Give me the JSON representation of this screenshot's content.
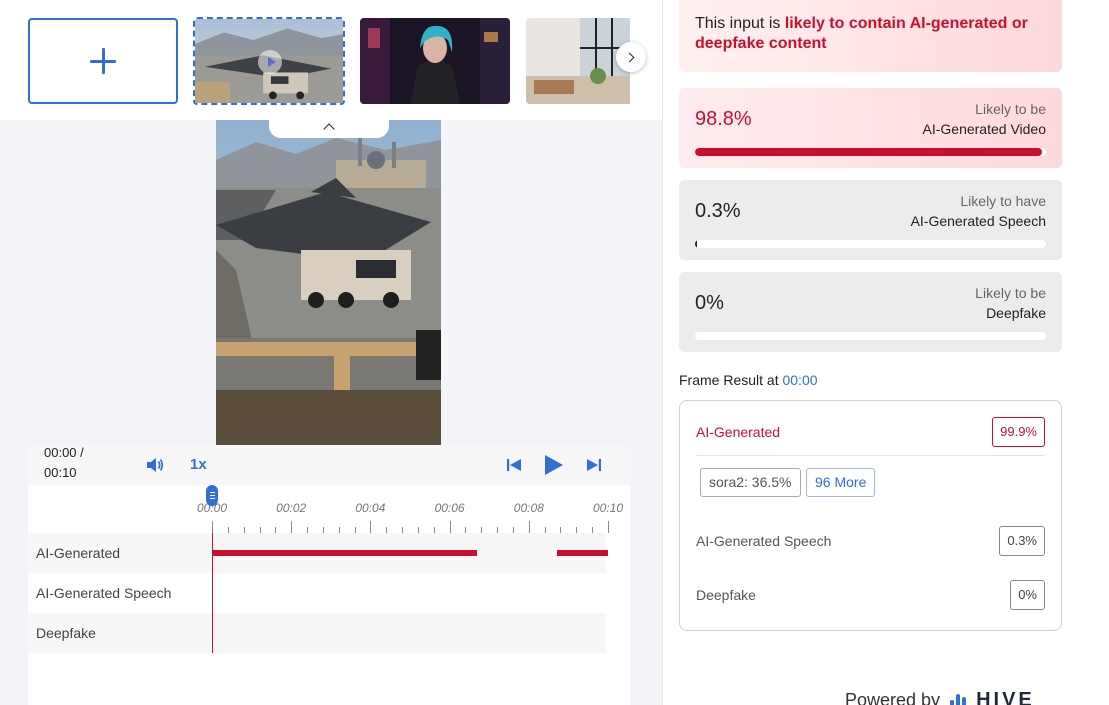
{
  "gallery": {
    "upload_label": "",
    "thumbnails": [
      {
        "name": "video-sample-aircraft-truck",
        "selected": true,
        "has_play": true
      },
      {
        "name": "image-sample-cyberpunk-woman",
        "selected": false
      },
      {
        "name": "image-sample-living-room",
        "selected": false
      }
    ]
  },
  "player": {
    "time_current": "00:00 /",
    "time_total": "00:10",
    "speed": "1x",
    "ticks": [
      "00:00",
      "00:02",
      "00:04",
      "00:06",
      "00:08",
      "00:10"
    ],
    "duration_seconds": 10,
    "playhead_seconds": 0,
    "tracks": [
      {
        "label": "AI-Generated",
        "segments": [
          [
            0,
            6.7
          ],
          [
            8.7,
            10
          ]
        ]
      },
      {
        "label": "AI-Generated Speech",
        "segments": []
      },
      {
        "label": "Deepfake",
        "segments": []
      }
    ]
  },
  "banner": {
    "prefix": "This input is ",
    "highlight": "likely to contain AI-generated or deepfake content"
  },
  "scores": [
    {
      "percent_text": "98.8%",
      "value": 0.988,
      "line1": "Likely to be",
      "line2": "AI-Generated Video"
    },
    {
      "percent_text": "0.3%",
      "value": 0.003,
      "line1": "Likely to have",
      "line2": "AI-Generated Speech"
    },
    {
      "percent_text": "0%",
      "value": 0.0,
      "line1": "Likely to be",
      "line2": "Deepfake"
    }
  ],
  "frame_result": {
    "title_prefix": "Frame Result at ",
    "time": "00:00",
    "rows": [
      {
        "label": "AI-Generated",
        "value": "99.9%"
      },
      {
        "label": "AI-Generated Speech",
        "value": "0.3%"
      },
      {
        "label": "Deepfake",
        "value": "0%"
      }
    ],
    "chips": [
      "sora2: 36.5%",
      "96 More"
    ]
  },
  "footer": {
    "powered_by": "Powered by",
    "brand": "HIVE"
  },
  "colors": {
    "accent": "#2f6fd6",
    "alert": "#c8102e"
  }
}
